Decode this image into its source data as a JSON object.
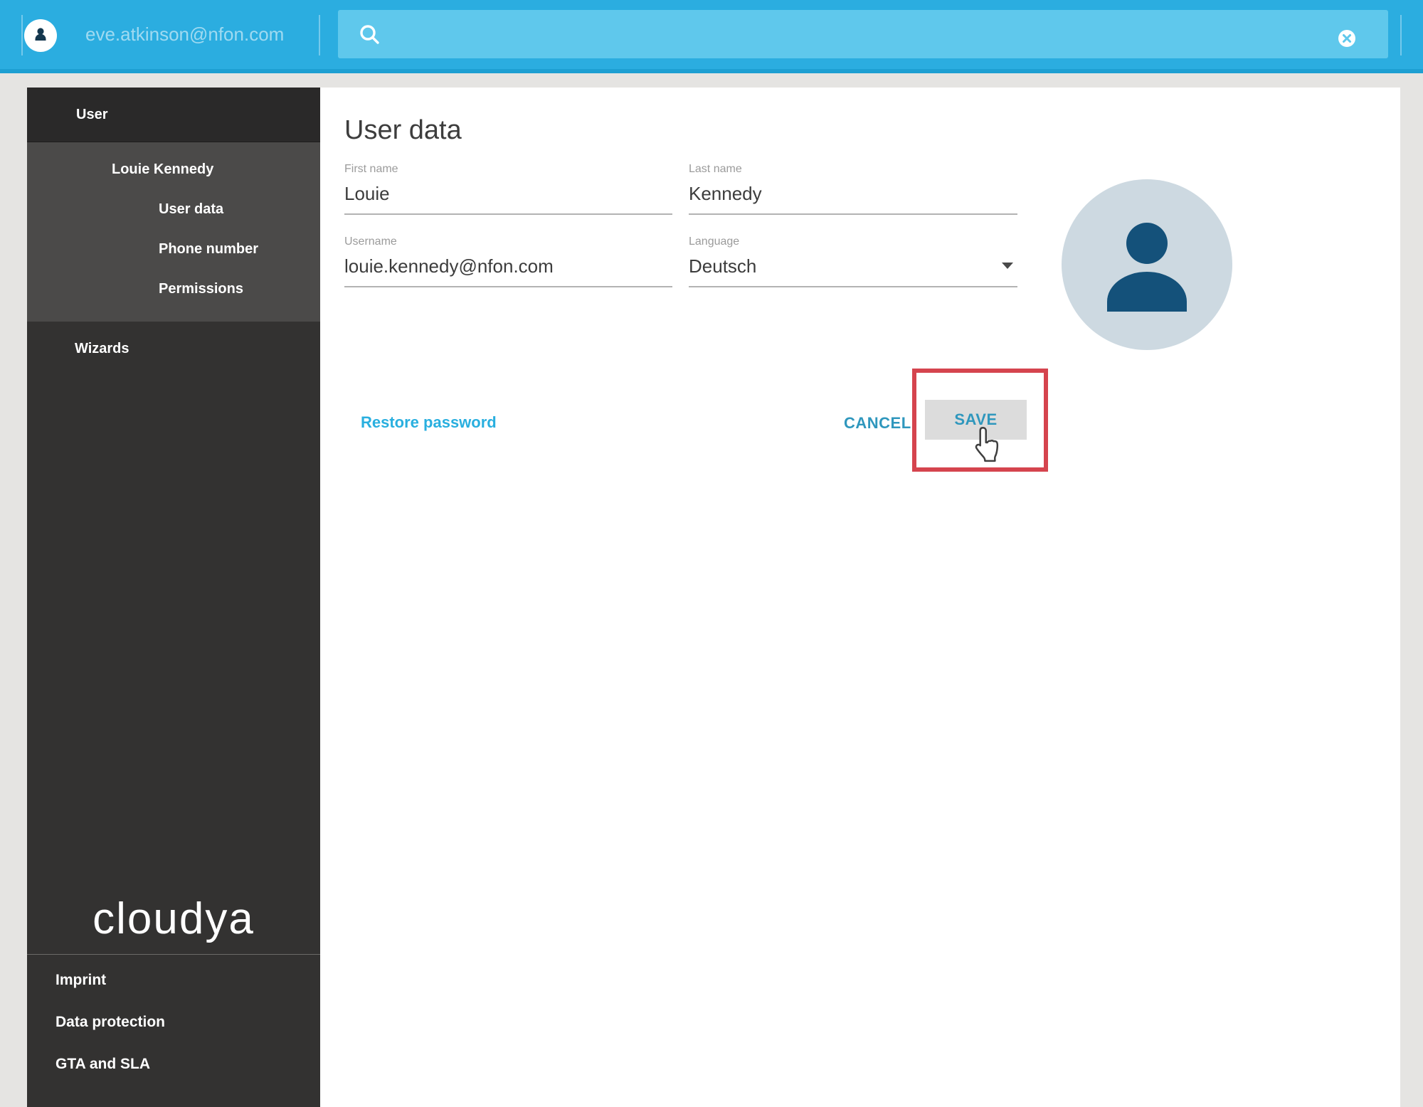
{
  "topbar": {
    "user_email": "eve.atkinson@nfon.com",
    "search": {
      "value": "",
      "placeholder": ""
    }
  },
  "sidebar": {
    "section_user": "User",
    "user_name": "Louie Kennedy",
    "sub_items": [
      "User data",
      "Phone number",
      "Permissions"
    ],
    "section_wizards": "Wizards",
    "logo_text": "cloudya",
    "footer_links": [
      "Imprint",
      "Data protection",
      "GTA and SLA"
    ]
  },
  "main": {
    "title": "User data",
    "fields": {
      "first_name": {
        "label": "First name",
        "value": "Louie"
      },
      "last_name": {
        "label": "Last name",
        "value": "Kennedy"
      },
      "username": {
        "label": "Username",
        "value": "louie.kennedy@nfon.com"
      },
      "language": {
        "label": "Language",
        "value": "Deutsch"
      }
    },
    "restore_password_label": "Restore password",
    "cancel_label": "CANCEL",
    "save_label": "SAVE"
  },
  "icons": {
    "topbar_avatar": "person-icon",
    "search": "search-icon",
    "clear_search": "clear-icon",
    "language_dropdown": "chevron-down-icon",
    "profile_avatar": "person-icon",
    "annotation_cursor": "hand-pointer-icon"
  },
  "colors": {
    "topbar_bg": "#2bade0",
    "searchbox_bg": "#5fc8ec",
    "accent_link": "#29afdf",
    "button_text": "#2f97bd",
    "annotation_red": "#d5444e",
    "sidebar_bg": "#333231",
    "sidebar_submenu_bg": "#4b4a49",
    "avatar_bg": "#cdd9e1",
    "avatar_icon": "#14517a"
  }
}
